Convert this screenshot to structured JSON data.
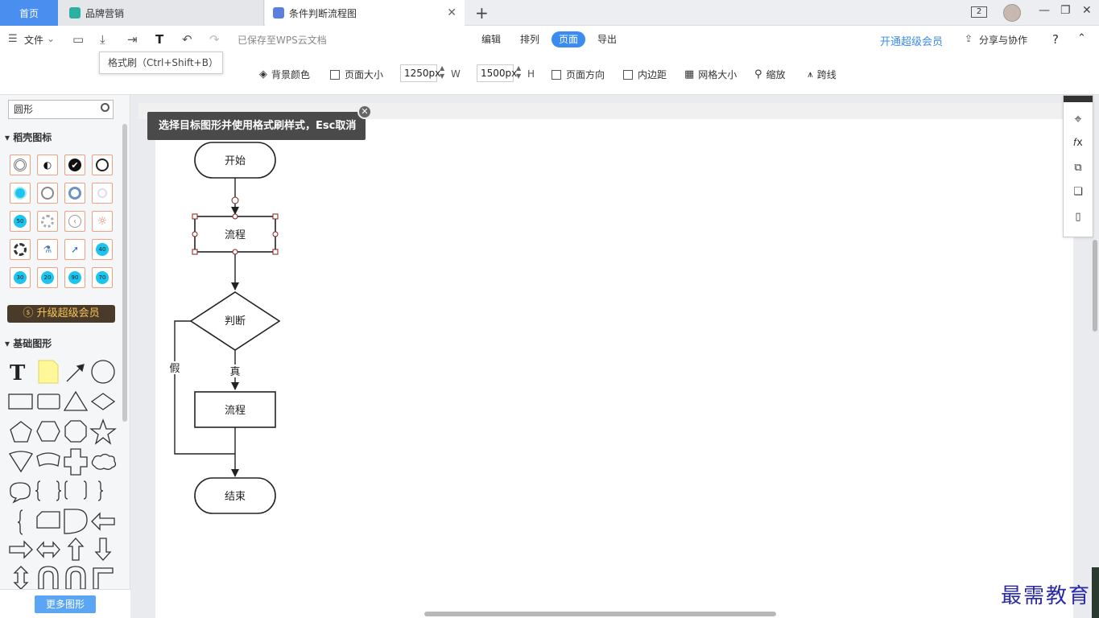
{
  "titlebar": {
    "tabs": [
      {
        "label": "首页"
      },
      {
        "label": "品牌营销"
      },
      {
        "label": "条件判断流程图"
      }
    ],
    "new_tab": "+",
    "window_badge": "2"
  },
  "toolbar": {
    "file_label": "文件",
    "saved_status": "已保存至WPS云文档",
    "menu_tabs": [
      "编辑",
      "排列",
      "页面",
      "导出"
    ],
    "active_menu": "页面",
    "vip_link": "开通超级会员",
    "share": "分享与协作",
    "help": "?"
  },
  "tooltip": {
    "text": "格式刷（Ctrl+Shift+B）"
  },
  "page_toolbar": {
    "background": "背景颜色",
    "page_size": "页面大小",
    "width_value": "1250px",
    "width_unit": "W",
    "height_value": "1500px",
    "height_unit": "H",
    "orientation": "页面方向",
    "padding": "内边距",
    "grid_size": "网格大小",
    "zoom": "缩放",
    "jump_line": "跨线"
  },
  "left_panel": {
    "search_value": "圆形",
    "section1": "稻壳图标",
    "upgrade_btn": "升级超级会员",
    "section2": "基础图形",
    "more_shapes": "更多图形",
    "badges": [
      "50",
      "40",
      "30",
      "20",
      "90",
      "70"
    ]
  },
  "canvas": {
    "hint": "选择目标图形并使用格式刷样式，Esc取消",
    "nodes": {
      "start": "开始",
      "process1": "流程",
      "decision": "判断",
      "process2": "流程",
      "end": "结束"
    },
    "edge_labels": {
      "yes": "真",
      "no": "假"
    }
  },
  "watermark": "最需教育",
  "colors": {
    "accent": "#3b8cf0",
    "home_tab": "#4a8ff0",
    "upgrade_bg": "#4a3a2a",
    "upgrade_text": "#f6c458",
    "icon_border": "#f0a080",
    "badge_fill": "#1cc4f0"
  }
}
